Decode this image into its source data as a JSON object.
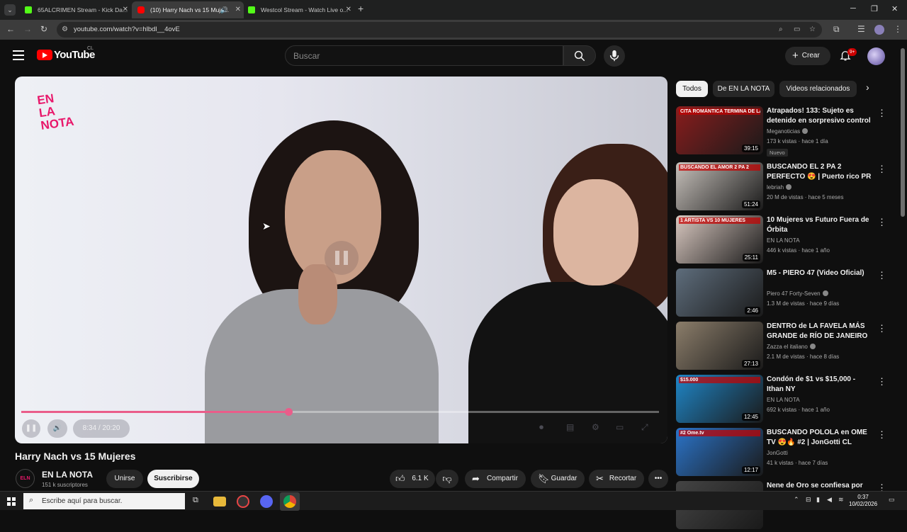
{
  "browser": {
    "tab_menu": "⌄",
    "tabs": [
      {
        "title": "65ALCRIMEN Stream - Kick Da...",
        "favicon": "kick-icon"
      },
      {
        "title": "(10) Harry Nach vs 15 Muje...",
        "favicon": "youtube-icon"
      },
      {
        "title": "Westcol Stream - Watch Live o...",
        "favicon": "kick-icon"
      }
    ],
    "url": "youtube.com/watch?v=hlbdl__4ovE"
  },
  "header": {
    "logo_text": "YouTube",
    "region": "CL",
    "search_placeholder": "Buscar",
    "create_label": "Crear",
    "notifications": "9+"
  },
  "player": {
    "brand": "EN LA NOTA",
    "time_current": "8:34",
    "time_total": "20:20",
    "progress_played": 0.4189,
    "progress_buffered": 0.42
  },
  "video": {
    "title": "Harry Nach vs 15 Mujeres",
    "channel": "EN LA NOTA",
    "subscribers": "151 k suscriptores",
    "join_label": "Unirse",
    "subscribe_label": "Suscribirse",
    "likes": "6.1 K",
    "share_label": "Compartir",
    "save_label": "Guardar",
    "clip_label": "Recortar"
  },
  "sidebar": {
    "chips": [
      "Todos",
      "De EN LA NOTA",
      "Videos relacionados"
    ],
    "recommendations": [
      {
        "title": "Atrapados! 133: Sujeto es detenido en sorpresivo control ...",
        "channel": "Meganoticias",
        "verified": true,
        "views": "173 k vistas",
        "age": "hace 1 día",
        "duration": "39:15",
        "badge": "Nuevo",
        "thumb_text": "CITA ROMÁNTICA TERMINA DE LA PEOR MANERA",
        "thumb_color": "#8a1d1d"
      },
      {
        "title": "BUSCANDO EL 2 PA 2 PERFECTO 😍 | Puerto rico PR",
        "channel": "lebriah",
        "verified": true,
        "views": "20 M de vistas",
        "age": "hace 5 meses",
        "duration": "51:24",
        "badge": "",
        "thumb_text": "BUSCANDO EL AMOR 2 PA 2",
        "thumb_color": "#c7c1bb"
      },
      {
        "title": "10 Mujeres vs Futuro Fuera de Órbita",
        "channel": "EN LA NOTA",
        "verified": false,
        "views": "446 k vistas",
        "age": "hace 1 año",
        "duration": "25:11",
        "badge": "",
        "thumb_text": "1 ARTISTA VS 10 MUJERES",
        "thumb_color": "#d9c8c0"
      },
      {
        "title": "M5 - PIERO 47 (Video Oficial)",
        "channel": "Piero 47 Forty-Seven",
        "verified": true,
        "views": "1.3 M de vistas",
        "age": "hace 9 días",
        "duration": "2:46",
        "badge": "",
        "thumb_text": "",
        "thumb_color": "#5e6d7c"
      },
      {
        "title": "DENTRO de LA FAVELA MÁS GRANDE de RÍO DE JANEIRO (...",
        "channel": "Zazza el italiano",
        "verified": true,
        "views": "2.1 M de vistas",
        "age": "hace 8 días",
        "duration": "27:13",
        "badge": "",
        "thumb_text": "",
        "thumb_color": "#8b7d6a"
      },
      {
        "title": "Condón de $1 vs $15,000 - Ithan NY",
        "channel": "EN LA NOTA",
        "verified": false,
        "views": "692 k vistas",
        "age": "hace 1 año",
        "duration": "12:45",
        "badge": "",
        "thumb_text": "$15.000",
        "thumb_color": "#1f86c7"
      },
      {
        "title": "BUSCANDO POLOLA en OME TV 😍🔥 #2 | JonGotti CL",
        "channel": "JonGotti",
        "verified": false,
        "views": "41 k vistas",
        "age": "hace 7 días",
        "duration": "12:17",
        "badge": "",
        "thumb_text": "#2 Ome.tv",
        "thumb_color": "#2b74c9"
      },
      {
        "title": "Nene de Oro se confiesa por",
        "channel": "",
        "verified": false,
        "views": "",
        "age": "",
        "duration": "",
        "badge": "",
        "thumb_text": "",
        "thumb_color": "#444444"
      }
    ]
  },
  "taskbar": {
    "search_placeholder": "Escribe aquí para buscar.",
    "time": "0:37",
    "date": "10/02/2026"
  }
}
